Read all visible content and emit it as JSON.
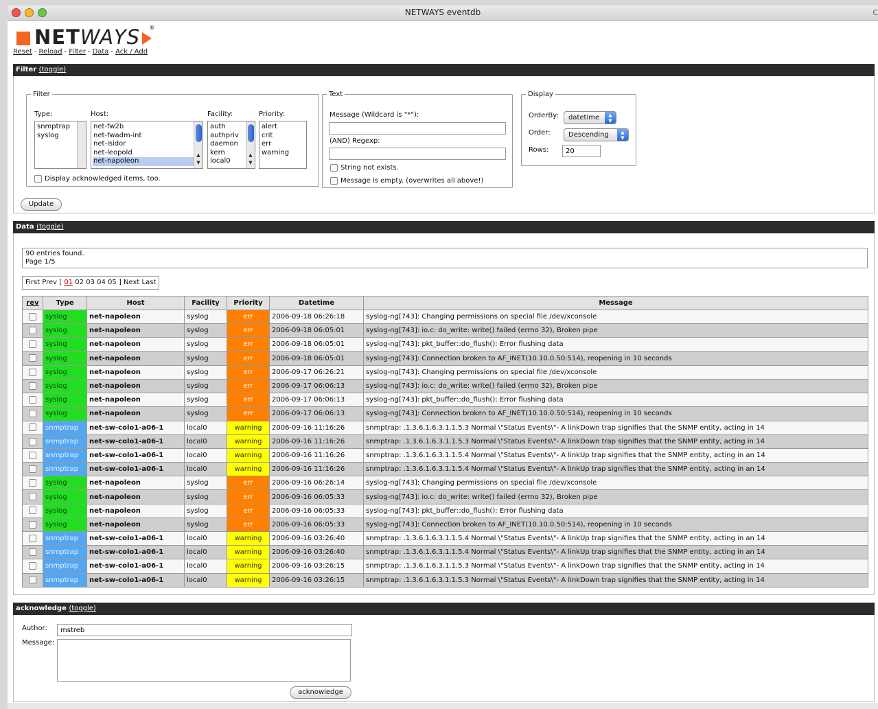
{
  "window": {
    "title": "NETWAYS eventdb",
    "title_right": "C"
  },
  "logo": {
    "net": "NET",
    "ways": "WAYS",
    "reg": "®"
  },
  "nav": [
    "Reset",
    "Reload",
    "Filter",
    "Data",
    "Ack / Add"
  ],
  "filter_section": {
    "title": "Filter",
    "toggle": "(toggle)",
    "filter_legend": "Filter",
    "type_label": "Type:",
    "type_options": [
      "snmptrap",
      "syslog"
    ],
    "host_label": "Host:",
    "host_options": [
      "net-fw2b",
      "net-fwadm-int",
      "net-isidor",
      "net-leopold",
      "net-napoleon"
    ],
    "host_selected": "net-napoleon",
    "facility_label": "Facility:",
    "facility_options": [
      "auth",
      "authpriv",
      "daemon",
      "kern",
      "local0"
    ],
    "priority_label": "Priority:",
    "priority_options": [
      "alert",
      "crit",
      "err",
      "warning"
    ],
    "display_ack": "Display acknowledged items, too.",
    "text_legend": "Text",
    "message_label": "Message (Wildcard is \"*\"):",
    "regexp_label": "(AND) Regexp:",
    "string_not_exists": "String not exists.",
    "message_empty": "Message is empty. (overwrites all above!)",
    "display_legend": "Display",
    "orderby_label": "OrderBy:",
    "orderby_value": "datetime",
    "order_label": "Order:",
    "order_value": "Descending",
    "rows_label": "Rows:",
    "rows_value": "20",
    "update_button": "Update"
  },
  "data_section": {
    "title": "Data",
    "toggle": "(toggle)",
    "entries_found": "90 entries found.",
    "page_info": "Page 1/5",
    "pager": {
      "first": "First",
      "prev": "Prev",
      "open": "[",
      "current": "01",
      "pages": [
        "02",
        "03",
        "04",
        "05"
      ],
      "close": "]",
      "next": "Next",
      "last": "Last"
    },
    "columns": [
      "rev",
      "Type",
      "Host",
      "Facility",
      "Priority",
      "Datetime",
      "Message"
    ],
    "rows": [
      {
        "type": "syslog",
        "host": "net-napoleon",
        "facility": "syslog",
        "priority": "err",
        "datetime": "2006-09-18 06:26:18",
        "message": "syslog-ng[743]: Changing permissions on special file /dev/xconsole"
      },
      {
        "type": "syslog",
        "host": "net-napoleon",
        "facility": "syslog",
        "priority": "err",
        "datetime": "2006-09-18 06:05:01",
        "message": "syslog-ng[743]: io.c: do_write: write() failed (errno 32), Broken pipe"
      },
      {
        "type": "syslog",
        "host": "net-napoleon",
        "facility": "syslog",
        "priority": "err",
        "datetime": "2006-09-18 06:05:01",
        "message": "syslog-ng[743]: pkt_buffer::do_flush(): Error flushing data"
      },
      {
        "type": "syslog",
        "host": "net-napoleon",
        "facility": "syslog",
        "priority": "err",
        "datetime": "2006-09-18 06:05:01",
        "message": "syslog-ng[743]: Connection broken to AF_INET(10.10.0.50:514), reopening in 10 seconds"
      },
      {
        "type": "syslog",
        "host": "net-napoleon",
        "facility": "syslog",
        "priority": "err",
        "datetime": "2006-09-17 06:26:21",
        "message": "syslog-ng[743]: Changing permissions on special file /dev/xconsole"
      },
      {
        "type": "syslog",
        "host": "net-napoleon",
        "facility": "syslog",
        "priority": "err",
        "datetime": "2006-09-17 06:06:13",
        "message": "syslog-ng[743]: io.c: do_write: write() failed (errno 32), Broken pipe"
      },
      {
        "type": "syslog",
        "host": "net-napoleon",
        "facility": "syslog",
        "priority": "err",
        "datetime": "2006-09-17 06:06:13",
        "message": "syslog-ng[743]: pkt_buffer::do_flush(): Error flushing data"
      },
      {
        "type": "syslog",
        "host": "net-napoleon",
        "facility": "syslog",
        "priority": "err",
        "datetime": "2006-09-17 06:06:13",
        "message": "syslog-ng[743]: Connection broken to AF_INET(10.10.0.50:514), reopening in 10 seconds"
      },
      {
        "type": "snmptrap",
        "host": "net-sw-colo1-a06-1",
        "facility": "local0",
        "priority": "warning",
        "datetime": "2006-09-16 11:16:26",
        "message": "snmptrap: .1.3.6.1.6.3.1.1.5.3 Normal \\\"Status Events\\\"- A linkDown trap signifies that the SNMP entity, acting in 14"
      },
      {
        "type": "snmptrap",
        "host": "net-sw-colo1-a06-1",
        "facility": "local0",
        "priority": "warning",
        "datetime": "2006-09-16 11:16:26",
        "message": "snmptrap: .1.3.6.1.6.3.1.1.5.3 Normal \\\"Status Events\\\"- A linkDown trap signifies that the SNMP entity, acting in 14"
      },
      {
        "type": "snmptrap",
        "host": "net-sw-colo1-a06-1",
        "facility": "local0",
        "priority": "warning",
        "datetime": "2006-09-16 11:16:26",
        "message": "snmptrap: .1.3.6.1.6.3.1.1.5.4 Normal \\\"Status Events\\\"- A linkUp trap signifies that the SNMP entity, acting in an 14"
      },
      {
        "type": "snmptrap",
        "host": "net-sw-colo1-a06-1",
        "facility": "local0",
        "priority": "warning",
        "datetime": "2006-09-16 11:16:26",
        "message": "snmptrap: .1.3.6.1.6.3.1.1.5.4 Normal \\\"Status Events\\\"- A linkUp trap signifies that the SNMP entity, acting in an 14"
      },
      {
        "type": "syslog",
        "host": "net-napoleon",
        "facility": "syslog",
        "priority": "err",
        "datetime": "2006-09-16 06:26:14",
        "message": "syslog-ng[743]: Changing permissions on special file /dev/xconsole"
      },
      {
        "type": "syslog",
        "host": "net-napoleon",
        "facility": "syslog",
        "priority": "err",
        "datetime": "2006-09-16 06:05:33",
        "message": "syslog-ng[743]: io.c: do_write: write() failed (errno 32), Broken pipe"
      },
      {
        "type": "syslog",
        "host": "net-napoleon",
        "facility": "syslog",
        "priority": "err",
        "datetime": "2006-09-16 06:05:33",
        "message": "syslog-ng[743]: pkt_buffer::do_flush(): Error flushing data"
      },
      {
        "type": "syslog",
        "host": "net-napoleon",
        "facility": "syslog",
        "priority": "err",
        "datetime": "2006-09-16 06:05:33",
        "message": "syslog-ng[743]: Connection broken to AF_INET(10.10.0.50:514), reopening in 10 seconds"
      },
      {
        "type": "snmptrap",
        "host": "net-sw-colo1-a06-1",
        "facility": "local0",
        "priority": "warning",
        "datetime": "2006-09-16 03:26:40",
        "message": "snmptrap: .1.3.6.1.6.3.1.1.5.4 Normal \\\"Status Events\\\"- A linkUp trap signifies that the SNMP entity, acting in an 14"
      },
      {
        "type": "snmptrap",
        "host": "net-sw-colo1-a06-1",
        "facility": "local0",
        "priority": "warning",
        "datetime": "2006-09-16 03:26:40",
        "message": "snmptrap: .1.3.6.1.6.3.1.1.5.4 Normal \\\"Status Events\\\"- A linkUp trap signifies that the SNMP entity, acting in an 14"
      },
      {
        "type": "snmptrap",
        "host": "net-sw-colo1-a06-1",
        "facility": "local0",
        "priority": "warning",
        "datetime": "2006-09-16 03:26:15",
        "message": "snmptrap: .1.3.6.1.6.3.1.1.5.3 Normal \\\"Status Events\\\"- A linkDown trap signifies that the SNMP entity, acting in 14"
      },
      {
        "type": "snmptrap",
        "host": "net-sw-colo1-a06-1",
        "facility": "local0",
        "priority": "warning",
        "datetime": "2006-09-16 03:26:15",
        "message": "snmptrap: .1.3.6.1.6.3.1.1.5.3 Normal \\\"Status Events\\\"- A linkDown trap signifies that the SNMP entity, acting in 14"
      }
    ]
  },
  "ack_section": {
    "title": "acknowledge",
    "toggle": "(toggle)",
    "author_label": "Author:",
    "author_value": "mstreb",
    "message_label": "Message:",
    "button": "acknowledge"
  },
  "colors": {
    "syslog": "#22dd22",
    "snmptrap": "#55a6f0",
    "err": "#ff7f00",
    "warning": "#ffff00",
    "brand": "#f26522"
  }
}
